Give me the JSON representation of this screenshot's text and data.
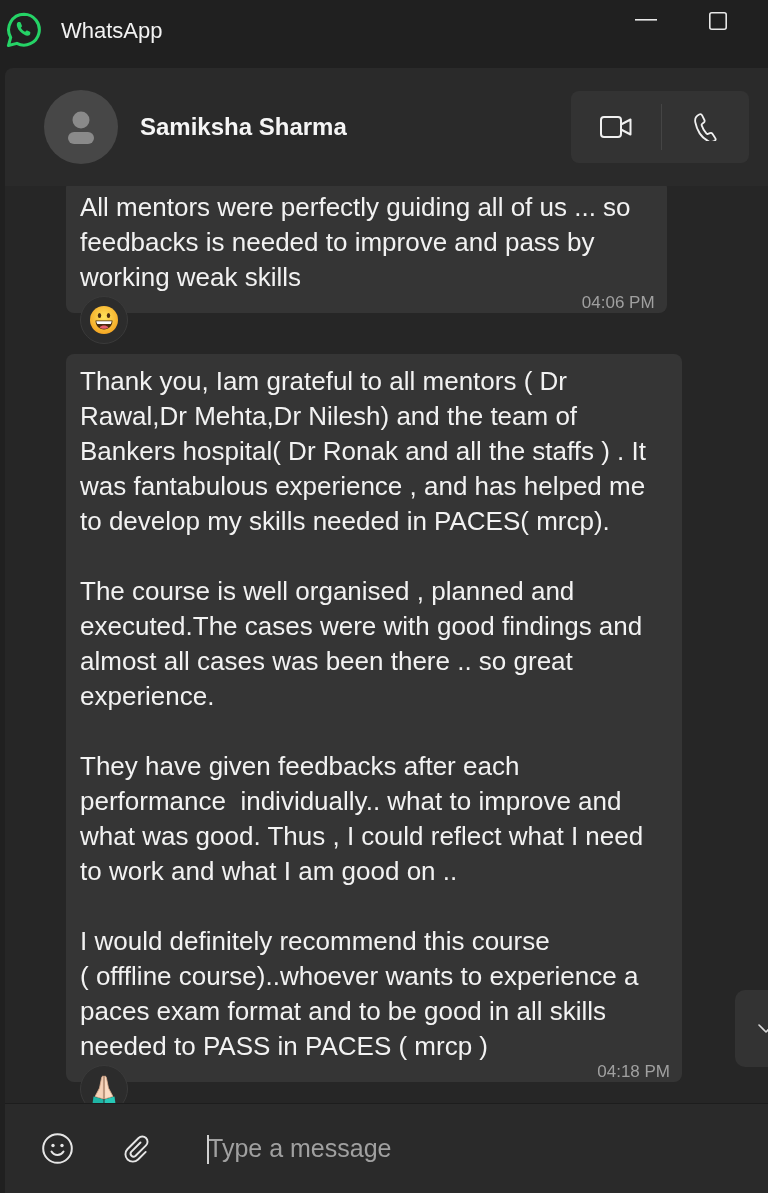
{
  "window": {
    "title": "WhatsApp"
  },
  "chat_header": {
    "contact_name": "Samiksha Sharma"
  },
  "messages": [
    {
      "paragraphs": [
        "All mentors were perfectly guiding all of us ... so\nfeedbacks is needed to improve and pass by\nworking weak skills"
      ],
      "time": "04:06 PM",
      "reaction": {
        "kind": "grinning"
      }
    },
    {
      "paragraphs": [
        "Thank you, Iam grateful to all mentors ( Dr\nRawal,Dr Mehta,Dr Nilesh) and the team of\nBankers hospital( Dr Ronak and all the staffs ) . It\nwas fantabulous experience , and has helped me\nto develop my skills needed in PACES( mrcp).",
        "The course is well organised , planned and\nexecuted.The cases were with good findings and\nalmost all cases was been there .. so great\nexperience.",
        "They have given feedbacks after each\nperformance  individually.. what to improve and\nwhat was good. Thus , I could reflect what I need\nto work and what I am good on ..",
        "I would definitely recommend this course\n( offfline course)..whoever wants to experience a\npaces exam format and to be good in all skills\nneeded to PASS in PACES ( mrcp )"
      ],
      "time": "04:18 PM",
      "reaction": {
        "kind": "praying"
      }
    }
  ],
  "composer": {
    "placeholder": "Type a message"
  }
}
